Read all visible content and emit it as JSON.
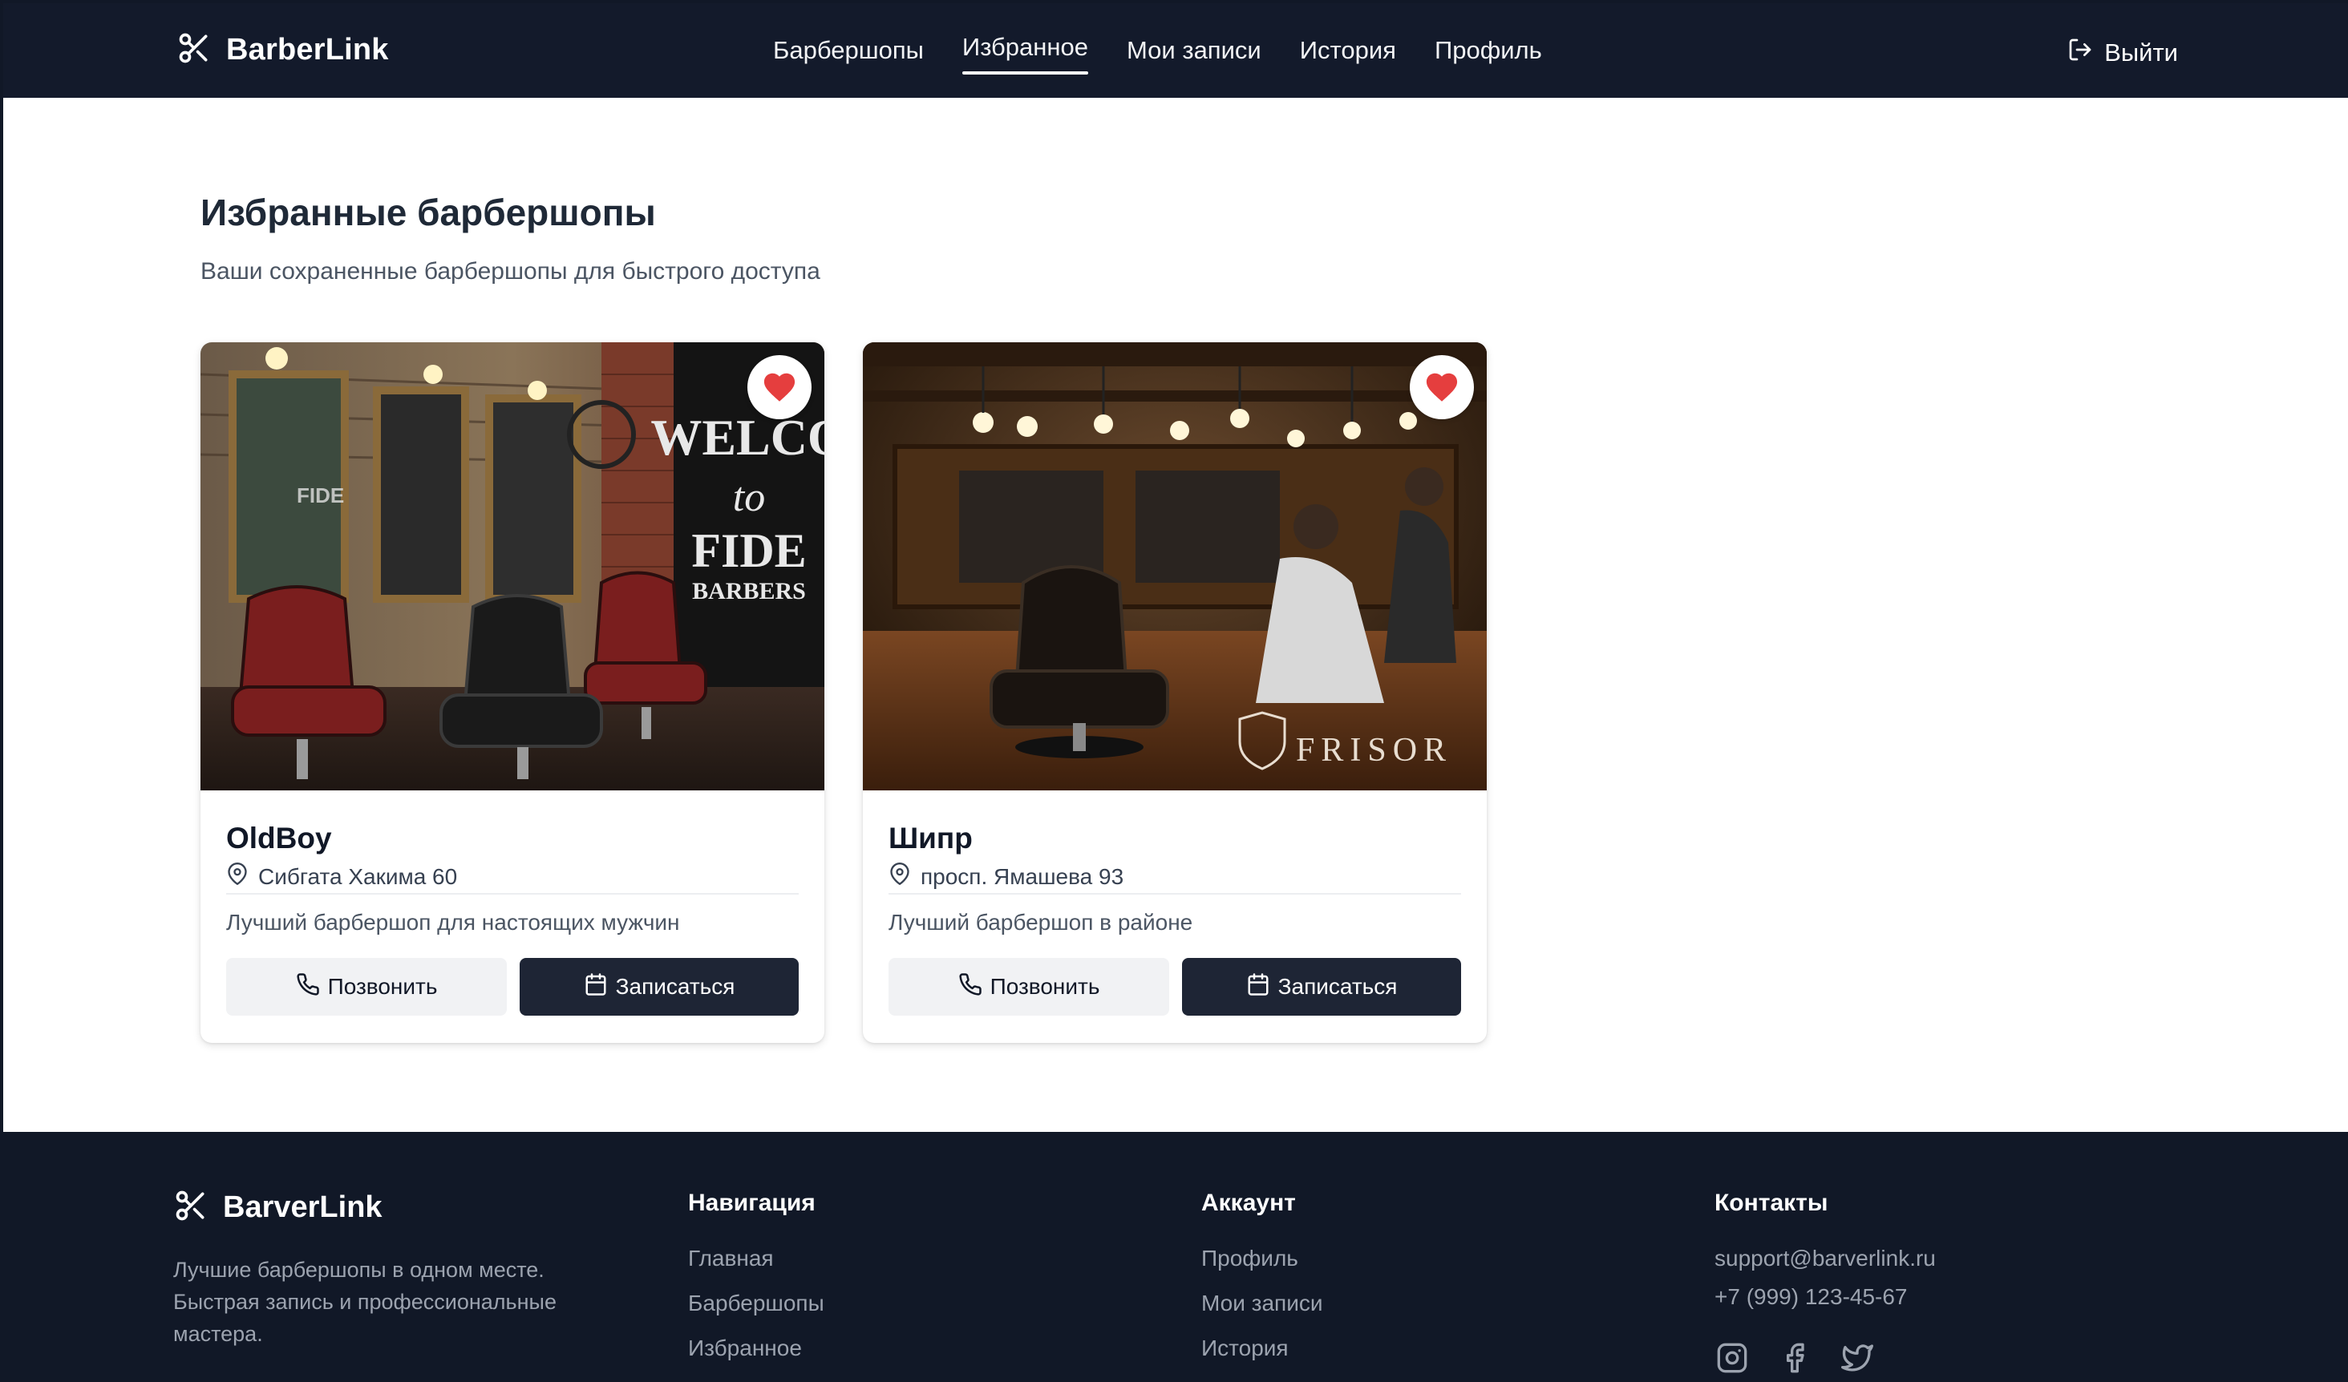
{
  "header": {
    "logo": "BarberLink",
    "nav": [
      {
        "label": "Барбершопы"
      },
      {
        "label": "Избранное",
        "active": true
      },
      {
        "label": "Мои записи"
      },
      {
        "label": "История"
      },
      {
        "label": "Профиль"
      }
    ],
    "logout": "Выйти"
  },
  "main": {
    "title": "Избранные барбершопы",
    "subtitle": "Ваши сохраненные барбершопы для быстрого доступа",
    "cards": [
      {
        "name": "OldBoy",
        "address": "Сибгата Хакима 60",
        "description": "Лучший барбершоп для настоящих мужчин",
        "call_label": "Позвонить",
        "book_label": "Записаться",
        "favorite": true,
        "image_text": [
          "WELCO",
          "to",
          "FIDE",
          "BARBERS"
        ]
      },
      {
        "name": "Шипр",
        "address": "просп. Ямашева 93",
        "description": "Лучший барбершоп в районе",
        "call_label": "Позвонить",
        "book_label": "Записаться",
        "favorite": true,
        "image_text": [
          "FRISOR"
        ]
      }
    ]
  },
  "footer": {
    "logo": "BarverLink",
    "description": "Лучшие барбершопы в одном месте. Быстрая запись и профессиональные мастера.",
    "nav_title": "Навигация",
    "nav_links": [
      "Главная",
      "Барбершопы",
      "Избранное"
    ],
    "account_title": "Аккаунт",
    "account_links": [
      "Профиль",
      "Мои записи",
      "История"
    ],
    "contacts_title": "Контакты",
    "email": "support@barverlink.ru",
    "phone": "+7 (999) 123-45-67"
  },
  "colors": {
    "header_bg": "#131a2b",
    "footer_bg": "#111827",
    "primary_button": "#1e2535",
    "heart": "#e53e3e"
  }
}
